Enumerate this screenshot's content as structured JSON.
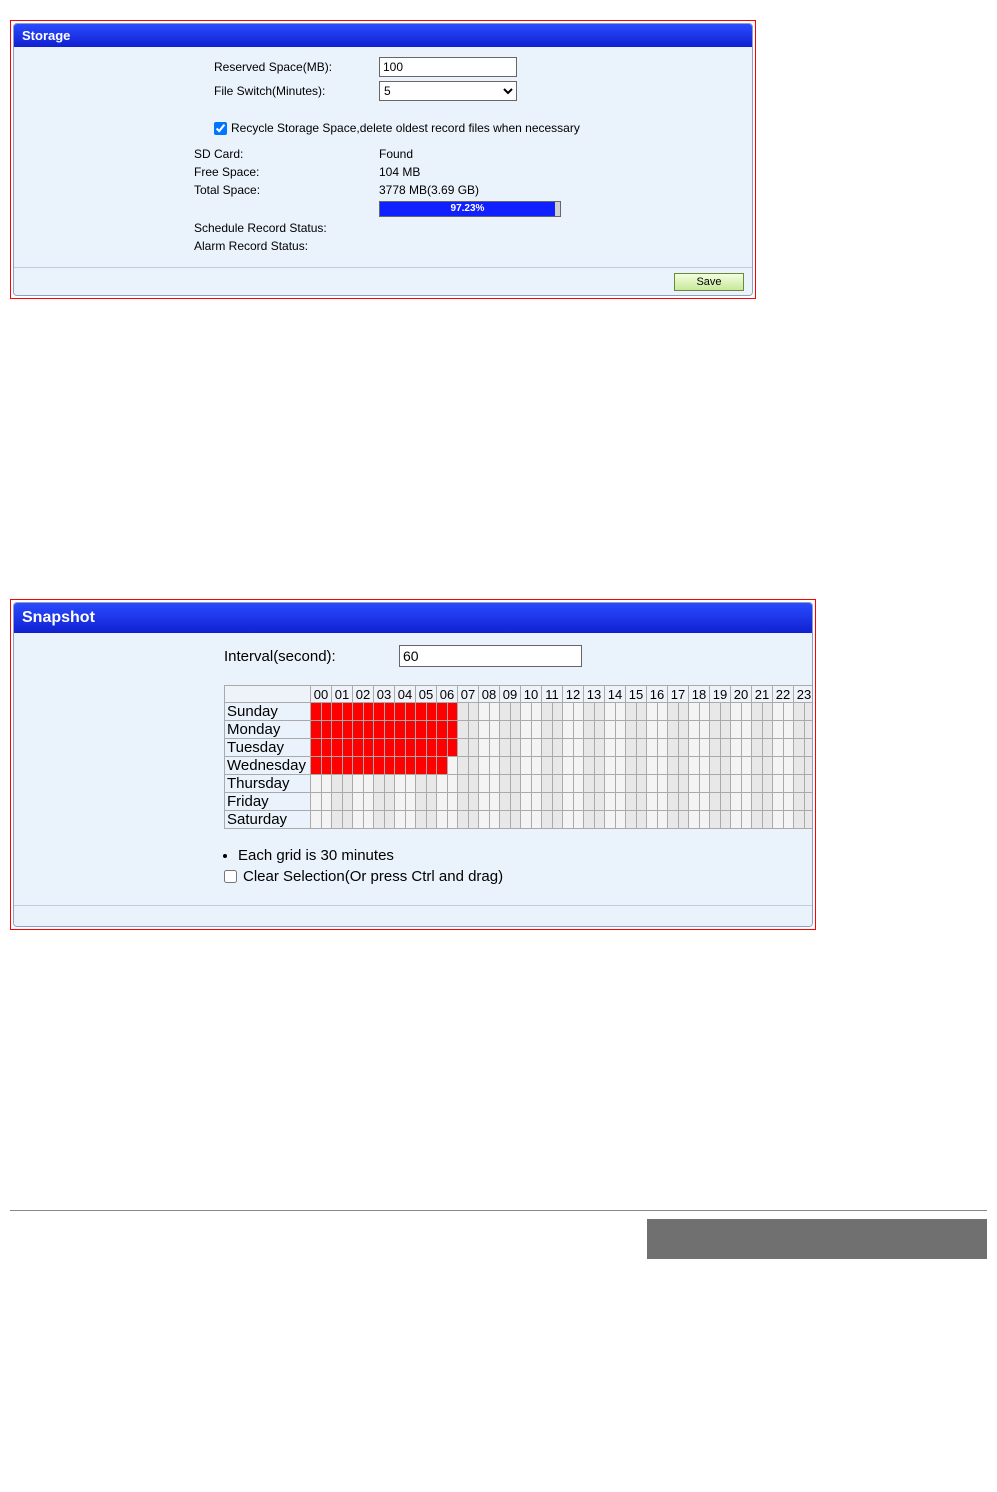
{
  "storage": {
    "title": "Storage",
    "reserved_label": "Reserved Space(MB):",
    "reserved_value": "100",
    "fileswitch_label": "File Switch(Minutes):",
    "fileswitch_value": "5",
    "recycle_label": "Recycle Storage Space,delete oldest record files when necessary",
    "sdcard_label": "SD Card:",
    "sdcard_value": "Found",
    "free_label": "Free Space:",
    "free_value": "104 MB",
    "total_label": "Total Space:",
    "total_value": "3778 MB(3.69 GB)",
    "progress_text": "97.23%",
    "schedule_status_label": "Schedule Record Status:",
    "alarm_status_label": "Alarm Record Status:",
    "save_btn": "Save"
  },
  "snapshot": {
    "title": "Snapshot",
    "interval_label": "Interval(second):",
    "interval_value": "60",
    "hours": [
      "00",
      "01",
      "02",
      "03",
      "04",
      "05",
      "06",
      "07",
      "08",
      "09",
      "10",
      "11",
      "12",
      "13",
      "14",
      "15",
      "16",
      "17",
      "18",
      "19",
      "20",
      "21",
      "22",
      "23"
    ],
    "days": [
      "Sunday",
      "Monday",
      "Tuesday",
      "Wednesday",
      "Thursday",
      "Friday",
      "Saturday"
    ],
    "selected_until_halfhour": {
      "Sunday": 14,
      "Monday": 14,
      "Tuesday": 14,
      "Wednesday": 13,
      "Thursday": 0,
      "Friday": 0,
      "Saturday": 0
    },
    "note_grid": "Each grid is 30 minutes",
    "clear_label": "Clear Selection(Or press Ctrl and drag)"
  }
}
